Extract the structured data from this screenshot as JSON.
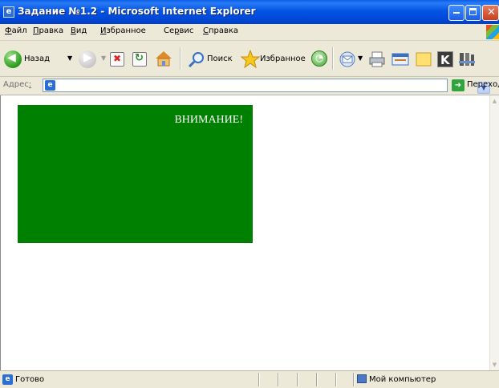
{
  "window": {
    "title": "Задание №1.2 - Microsoft Internet Explorer"
  },
  "menu": {
    "items": [
      {
        "underlined": "Ф",
        "rest": "айл"
      },
      {
        "underlined": "П",
        "rest": "равка"
      },
      {
        "underlined": "В",
        "rest": "ид"
      },
      {
        "underlined": "И",
        "rest": "збранное"
      },
      {
        "prefix": "Се",
        "underlined": "р",
        "rest": "вис"
      },
      {
        "underlined": "С",
        "rest": "правка"
      }
    ]
  },
  "toolbar": {
    "back_label": "Назад",
    "search_label": "Поиск",
    "favorites_label": "Избранное"
  },
  "address": {
    "label_main": "Адрес",
    "label_underlined": ":",
    "value": "",
    "go_label": "Переход"
  },
  "page": {
    "notice_text": "ВНИМАНИЕ!",
    "box_color": "#008000"
  },
  "status": {
    "text": "Готово",
    "zone": "Мой компьютер"
  }
}
